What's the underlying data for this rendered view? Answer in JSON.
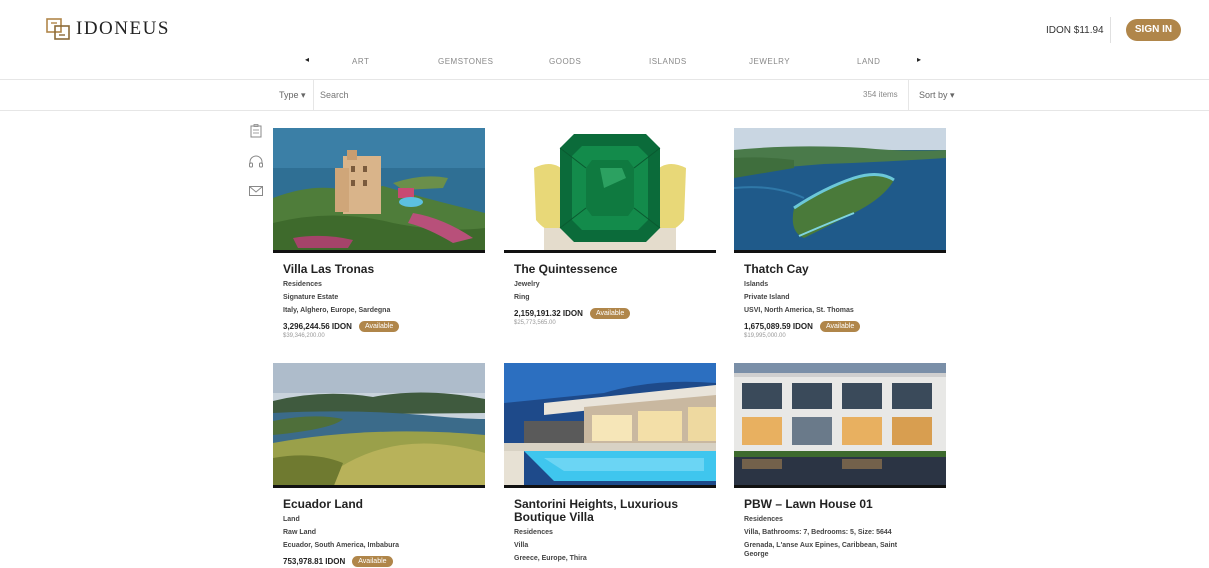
{
  "header": {
    "brand": "IDONEUS",
    "price": "IDON $11.94",
    "signin_label": "SIGN IN"
  },
  "nav": {
    "prev_arrow": "◂",
    "next_arrow": "▸",
    "items": [
      "ART",
      "GEMSTONES",
      "GOODS",
      "ISLANDS",
      "JEWELRY",
      "LAND"
    ]
  },
  "filters": {
    "type_label": "Type ▾",
    "search_placeholder": "Search",
    "count": "354 items",
    "sort_label": "Sort by ▾"
  },
  "side_icons": [
    "building-icon",
    "headset-icon",
    "mail-icon"
  ],
  "cards": [
    {
      "title": "Villa Las Tronas",
      "category": "Residences",
      "subtype": "Signature Estate",
      "location": "Italy, Alghero, Europe, Sardegna",
      "idon": "3,296,244.56 IDON",
      "badge": "Available",
      "usd": "$39,346,200.00"
    },
    {
      "title": "The Quintessence",
      "category": "Jewelry",
      "subtype": "Ring",
      "idon": "2,159,191.32 IDON",
      "badge": "Available",
      "usd": "$25,773,565.00"
    },
    {
      "title": "Thatch Cay",
      "category": "Islands",
      "subtype": "Private Island",
      "location": "USVI, North America, St. Thomas",
      "idon": "1,675,089.59 IDON",
      "badge": "Available",
      "usd": "$19,995,000.00"
    },
    {
      "title": "Ecuador Land",
      "category": "Land",
      "subtype": "Raw Land",
      "location": "Ecuador, South America, Imbabura",
      "idon": "753,978.81 IDON",
      "badge": "Available"
    },
    {
      "title": "Santorini Heights, Luxurious Boutique Villa",
      "category": "Residences",
      "subtype": "Villa",
      "location": "Greece, Europe, Thira"
    },
    {
      "title": "PBW – Lawn House 01",
      "category": "Residences",
      "subtype": "Villa, Bathrooms: 7, Bedrooms: 5, Size: 5644",
      "location": "Grenada, L'anse Aux Epines, Caribbean, Saint George"
    }
  ],
  "colors": {
    "accent": "#b0864a",
    "text": "#222222",
    "muted": "#888888"
  }
}
